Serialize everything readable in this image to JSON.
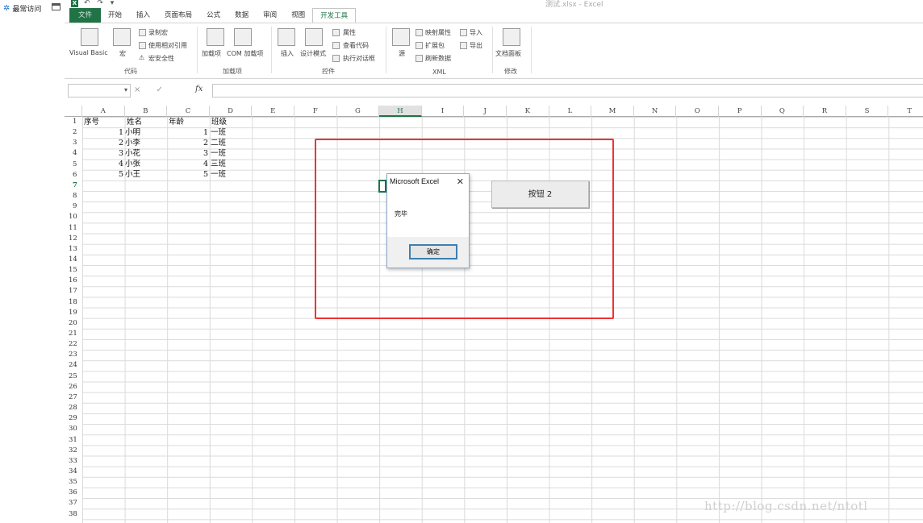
{
  "explorer": {
    "quick_access": "最常访问"
  },
  "window": {
    "title": "测试.xlsx - Excel",
    "logo": "X",
    "qat": "↶ ↷ ▾"
  },
  "tabs": [
    "文件",
    "开始",
    "插入",
    "页面布局",
    "公式",
    "数据",
    "审阅",
    "视图",
    "开发工具"
  ],
  "ribbon": {
    "code": {
      "visual_basic": "Visual Basic",
      "macros": "宏",
      "record": "录制宏",
      "relative": "使用相对引用",
      "security": "宏安全性",
      "group": "代码"
    },
    "addins": {
      "addins": "加载项",
      "com": "COM 加载项",
      "group": "加载项"
    },
    "controls": {
      "insert": "插入",
      "design": "设计模式",
      "properties": "属性",
      "view_code": "查看代码",
      "run_dialog": "执行对话框",
      "group": "控件"
    },
    "xml": {
      "source": "源",
      "map_props": "映射属性",
      "expansion": "扩展包",
      "refresh": "刷新数据",
      "import": "导入",
      "export": "导出",
      "group": "XML"
    },
    "modify": {
      "doc_panel": "文档面板",
      "group": "修改"
    }
  },
  "formula_bar": {
    "name_box": "",
    "fx": "fx",
    "buttons": "× ✓"
  },
  "columns": [
    "A",
    "B",
    "C",
    "D",
    "E",
    "F",
    "G",
    "H",
    "I",
    "J",
    "K",
    "L",
    "M",
    "N",
    "O",
    "P",
    "Q",
    "R",
    "S",
    "T"
  ],
  "selected_column": "H",
  "selected_row": 7,
  "rows": [
    "1",
    "2",
    "3",
    "4",
    "5",
    "6",
    "7",
    "8",
    "9",
    "10",
    "11",
    "12",
    "13",
    "14",
    "15",
    "16",
    "17",
    "18",
    "19",
    "20",
    "21",
    "22",
    "23",
    "24",
    "25",
    "26",
    "27",
    "28",
    "29",
    "30",
    "31",
    "32",
    "33",
    "34",
    "35",
    "36",
    "37",
    "38"
  ],
  "sheet": {
    "headers": [
      "序号",
      "姓名",
      "年龄",
      "班级"
    ],
    "data": [
      {
        "no": "1",
        "name": "小明",
        "class_no": "1",
        "class": "一班"
      },
      {
        "no": "2",
        "name": "小李",
        "class_no": "2",
        "class": "二班"
      },
      {
        "no": "3",
        "name": "小花",
        "class_no": "3",
        "class": "一班"
      },
      {
        "no": "4",
        "name": "小张",
        "class_no": "4",
        "class": "三班"
      },
      {
        "no": "5",
        "name": "小王",
        "class_no": "5",
        "class": "一班"
      }
    ]
  },
  "form_button": {
    "label": "按钮 2"
  },
  "dialog": {
    "title": "Microsoft Excel",
    "close": "✕",
    "message": "完毕",
    "ok": "确定"
  },
  "watermark": "http://blog.csdn.net/ntotl",
  "colors": {
    "excel_green": "#217346",
    "highlight": "#ee3333"
  }
}
